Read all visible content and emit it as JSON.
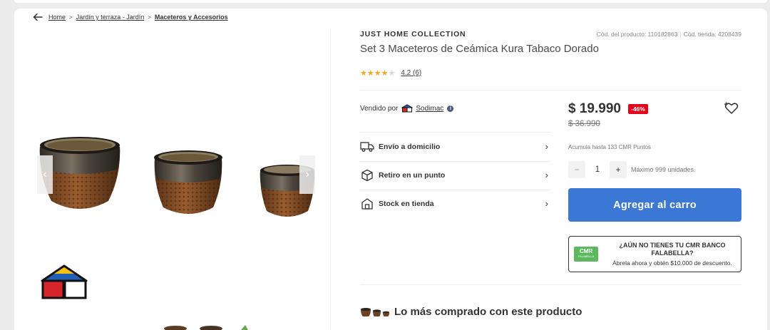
{
  "breadcrumb": {
    "items": [
      "Home",
      "Jardín y terraza - Jardín",
      "Maceteros y Accesorios"
    ],
    "separator": ">"
  },
  "product": {
    "brand": "JUST HOME COLLECTION",
    "product_code": "Cód. del producto: 110182863",
    "store_code": "Cód. tienda: 4208439",
    "title": "Set 3 Maceteros de Ceámica Kura Tabaco Dorado",
    "rating": 4.2,
    "rating_text": "4.2 (6)"
  },
  "seller": {
    "label": "Vendido por",
    "name": "Sodimac",
    "info_icon": "i"
  },
  "delivery": [
    {
      "label": "Envío a domicilio",
      "icon": "truck-icon"
    },
    {
      "label": "Retiro en un punto",
      "icon": "box-icon"
    },
    {
      "label": "Stock en tienda",
      "icon": "store-icon"
    }
  ],
  "pricing": {
    "price": "$ 19.990",
    "discount": "-46%",
    "old_price": "$ 36.990",
    "cmr_points": "Acumula hasta 133 CMR Puntos"
  },
  "quantity": {
    "minus": "−",
    "value": "1",
    "plus": "+",
    "max": "Máximo 999 unidades."
  },
  "cart": {
    "add_label": "Agregar al carro"
  },
  "cmr_promo": {
    "card_text": "CMR",
    "card_subtext": "FALABELLA",
    "title": "¿AÚN NO TIENES TU CMR BANCO FALABELLA?",
    "subtitle": "Ábrela ahora y obtén $10.000 de descuento."
  },
  "section": {
    "bought_together": "Lo más comprado con este producto"
  },
  "colors": {
    "accent": "#3b77d4",
    "discount": "#e4001b",
    "star": "#f5a623",
    "cmr": "#5cb85c"
  }
}
